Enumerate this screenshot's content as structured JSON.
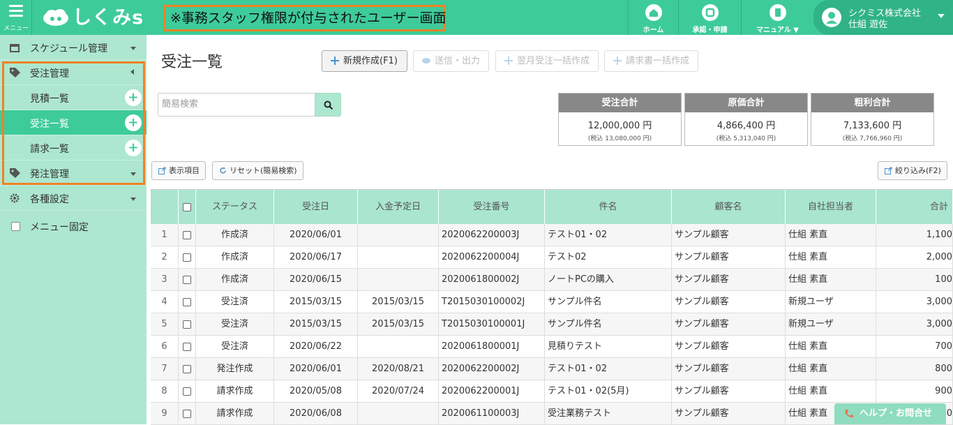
{
  "header": {
    "menu_label": "メニュー",
    "logo_text": "しくみs",
    "notice": "※事務スタッフ権限が付与されたユーザー画面",
    "nav": [
      {
        "label": "ホーム",
        "icon": "home-icon"
      },
      {
        "label": "承認・申請",
        "icon": "approval-icon"
      },
      {
        "label": "マニュアル ▼",
        "icon": "manual-icon"
      }
    ],
    "user": {
      "company": "シクミス株式会社",
      "name": "仕組 遊佐"
    }
  },
  "sidebar": {
    "schedule": "スケジュール管理",
    "order_mgmt": "受注管理",
    "estimate_list": "見積一覧",
    "order_list": "受注一覧",
    "invoice_list": "請求一覧",
    "purchase_mgmt": "発注管理",
    "settings": "各種設定",
    "menu_fix": "メニュー固定"
  },
  "main": {
    "title": "受注一覧",
    "buttons": {
      "new": "新規作成(F1)",
      "send": "送信・出力",
      "next_month": "翌月受注一括作成",
      "invoice_bulk": "請求書一括作成",
      "display_items": "表示項目",
      "reset": "リセット(簡易検索)",
      "filter": "絞り込み(F2)"
    },
    "search_placeholder": "簡易検索",
    "summary": [
      {
        "label": "受注合計",
        "value": "12,000,000 円",
        "tax": "(税込 13,080,000 円)"
      },
      {
        "label": "原価合計",
        "value": "4,866,400 円",
        "tax": "(税込 5,313,040 円)"
      },
      {
        "label": "粗利合計",
        "value": "7,133,600 円",
        "tax": "(税込 7,766,960 円)"
      }
    ]
  },
  "table": {
    "headers": [
      "ステータス",
      "受注日",
      "入金予定日",
      "受注番号",
      "件名",
      "顧客名",
      "自社担当者",
      "合計"
    ],
    "rows": [
      {
        "no": "1",
        "status": "作成済",
        "date": "2020/06/01",
        "pay": "",
        "num": "2020062200003J",
        "subject": "テスト01・02",
        "customer": "サンプル顧客",
        "staff": "仕組 素直",
        "total": "1,100"
      },
      {
        "no": "2",
        "status": "作成済",
        "date": "2020/06/17",
        "pay": "",
        "num": "2020062200004J",
        "subject": "テスト02",
        "customer": "サンプル顧客",
        "staff": "仕組 素直",
        "total": "2,000"
      },
      {
        "no": "3",
        "status": "作成済",
        "date": "2020/06/15",
        "pay": "",
        "num": "2020061800002J",
        "subject": "ノートPCの購入",
        "customer": "サンプル顧客",
        "staff": "仕組 素直",
        "total": "100"
      },
      {
        "no": "4",
        "status": "受注済",
        "date": "2015/03/15",
        "pay": "2015/03/15",
        "num": "T2015030100002J",
        "subject": "サンプル件名",
        "customer": "サンプル顧客",
        "staff": "新規ユーザ",
        "total": "3,000"
      },
      {
        "no": "5",
        "status": "受注済",
        "date": "2015/03/15",
        "pay": "2015/03/15",
        "num": "T2015030100001J",
        "subject": "サンプル件名",
        "customer": "サンプル顧客",
        "staff": "新規ユーザ",
        "total": "3,000"
      },
      {
        "no": "6",
        "status": "受注済",
        "date": "2020/06/22",
        "pay": "",
        "num": "2020061800001J",
        "subject": "見積りテスト",
        "customer": "サンプル顧客",
        "staff": "仕組 素直",
        "total": "700"
      },
      {
        "no": "7",
        "status": "発注作成",
        "date": "2020/06/01",
        "pay": "2020/08/21",
        "num": "2020062200002J",
        "subject": "テスト01・02",
        "customer": "サンプル顧客",
        "staff": "仕組 素直",
        "total": "800"
      },
      {
        "no": "8",
        "status": "請求作成",
        "date": "2020/05/08",
        "pay": "2020/07/24",
        "num": "2020062200001J",
        "subject": "テスト01・02(5月)",
        "customer": "サンプル顧客",
        "staff": "仕組 素直",
        "total": "900"
      },
      {
        "no": "9",
        "status": "請求作成",
        "date": "2020/06/08",
        "pay": "",
        "num": "2020061100003J",
        "subject": "受注業務テスト",
        "customer": "サンプル顧客",
        "staff": "仕組 素直",
        "total": "400"
      }
    ]
  },
  "help": "ヘルプ・お問合せ"
}
